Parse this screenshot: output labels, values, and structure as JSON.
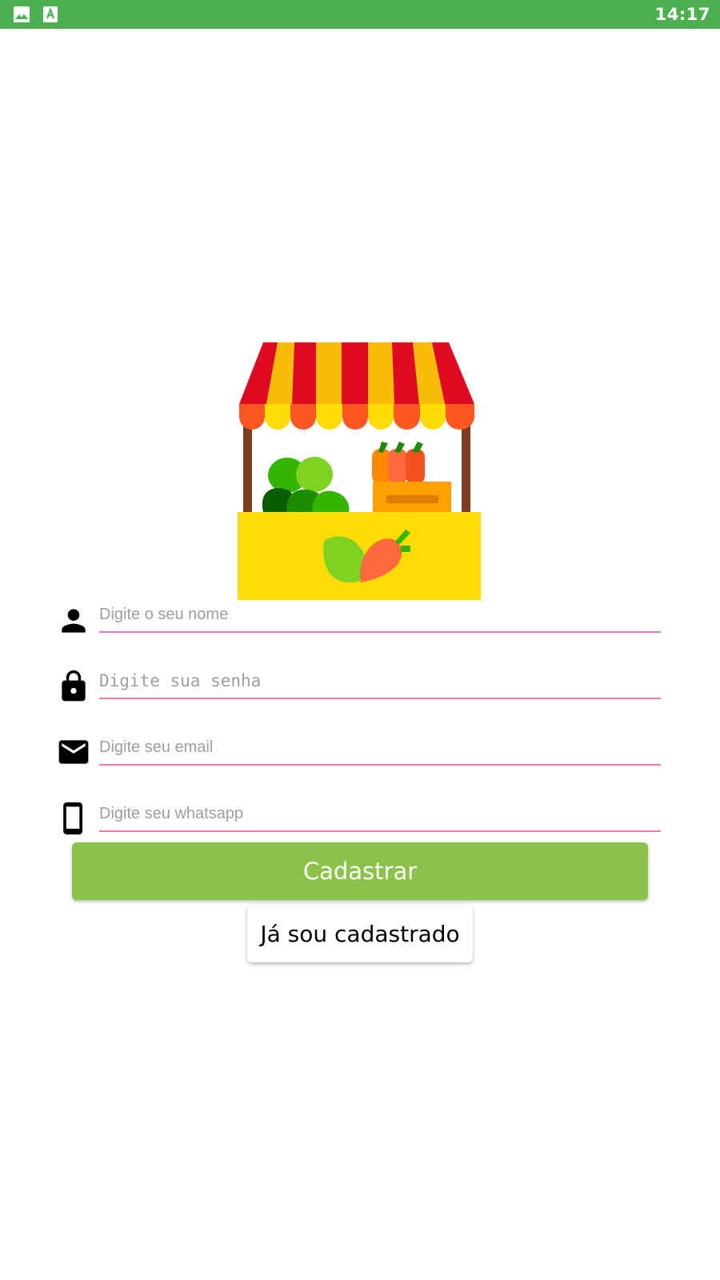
{
  "status_bar": {
    "time": "14:17",
    "background_color": "#4CAF50",
    "icons": [
      "image-notification-icon",
      "text-app-notification-icon"
    ]
  },
  "logo": {
    "icon": "market-stall-icon"
  },
  "form": {
    "name": {
      "placeholder": "Digite o seu nome",
      "value": "",
      "icon": "person-icon"
    },
    "password": {
      "placeholder": "Digite sua senha",
      "value": "",
      "icon": "lock-icon"
    },
    "email": {
      "placeholder": "Digite seu email",
      "value": "",
      "icon": "email-icon"
    },
    "whatsapp": {
      "placeholder": "Digite seu whatsapp",
      "value": "",
      "icon": "phone-icon"
    },
    "underline_color": "#F07AA4"
  },
  "buttons": {
    "register_label": "Cadastrar",
    "register_color": "#8BC34A",
    "login_label": "Já sou cadastrado"
  }
}
